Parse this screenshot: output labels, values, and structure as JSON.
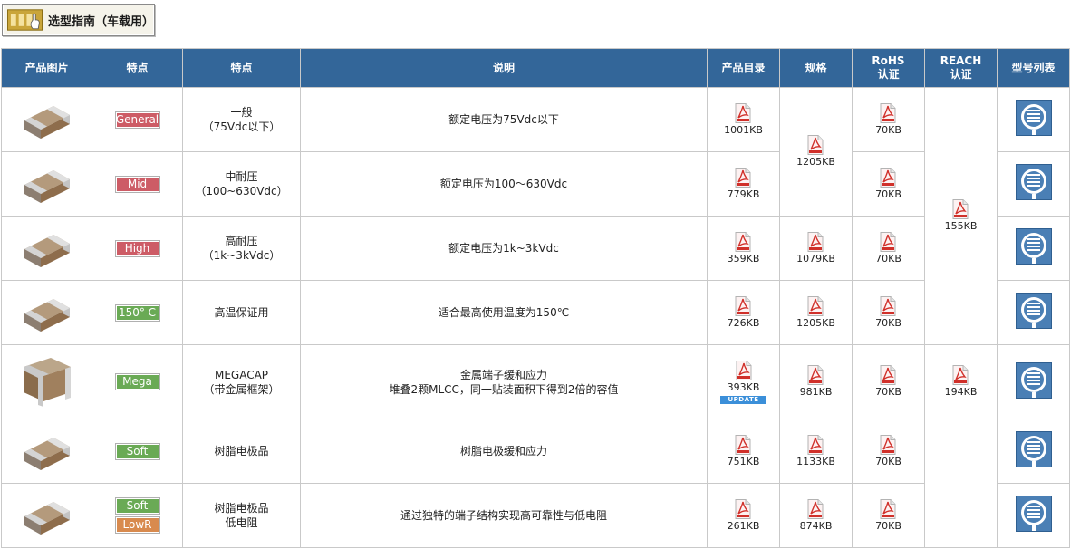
{
  "guide": {
    "label": "选型指南（车载用）",
    "icon": "guide-hand-icon"
  },
  "colors": {
    "header_bg": "#336699",
    "badge_red": "#cd5c66",
    "badge_green": "#6aaa55",
    "badge_orange": "#d88a4e",
    "update_badge": "#3b8fd9",
    "list_button": "#4a7fb5"
  },
  "headers": {
    "image": "产品图片",
    "feature_badge": "特点",
    "feature": "特点",
    "description": "说明",
    "catalog": "产品目录",
    "spec": "规格",
    "rohs_line1": "RoHS",
    "rohs_line2": "认证",
    "reach_line1": "REACH",
    "reach_line2": "认证",
    "model_list": "型号列表"
  },
  "rows": [
    {
      "badges": [
        {
          "text": "General",
          "color": "#cd5c66"
        }
      ],
      "feature": "一般\n（75Vdc以下）",
      "description": [
        "额定电压为75Vdc以下"
      ],
      "catalog": "1001KB",
      "spec": "1205KB",
      "rohs": "70KB",
      "reach": "155KB"
    },
    {
      "badges": [
        {
          "text": "Mid",
          "color": "#cd5c66"
        }
      ],
      "feature": "中耐压\n（100~630Vdc）",
      "description": [
        "额定电压为100～630Vdc"
      ],
      "catalog": "779KB",
      "spec": "",
      "rohs": "70KB",
      "reach": ""
    },
    {
      "badges": [
        {
          "text": "High",
          "color": "#cd5c66"
        }
      ],
      "feature": "高耐压\n（1k~3kVdc）",
      "description": [
        "额定电压为1k~3kVdc"
      ],
      "catalog": "359KB",
      "spec": "1079KB",
      "rohs": "70KB",
      "reach": ""
    },
    {
      "badges": [
        {
          "text": "150° C",
          "color": "#6aaa55"
        }
      ],
      "feature": "高温保证用",
      "description": [
        "适合最高使用温度为150℃"
      ],
      "catalog": "726KB",
      "spec": "1205KB",
      "rohs": "70KB",
      "reach": ""
    },
    {
      "badges": [
        {
          "text": "Mega",
          "color": "#6aaa55"
        }
      ],
      "feature": "MEGACAP\n（带金属框架）",
      "description": [
        "金属端子缓和应力",
        "堆叠2颗MLCC，同一贴装面积下得到2倍的容值"
      ],
      "catalog": "393KB",
      "catalog_update": "UPDATE",
      "spec": "981KB",
      "rohs": "70KB",
      "reach": "194KB"
    },
    {
      "badges": [
        {
          "text": "Soft",
          "color": "#6aaa55"
        }
      ],
      "feature": "树脂电极品",
      "description": [
        "树脂电极缓和应力"
      ],
      "catalog": "751KB",
      "spec": "1133KB",
      "rohs": "70KB",
      "reach": ""
    },
    {
      "badges": [
        {
          "text": "Soft",
          "color": "#6aaa55"
        },
        {
          "text": "LowR",
          "color": "#d88a4e"
        }
      ],
      "feature": "树脂电极品\n低电阻",
      "description": [
        "通过独特的端子结构实现高可靠性与低电阻"
      ],
      "catalog": "261KB",
      "spec": "874KB",
      "rohs": "70KB",
      "reach": ""
    }
  ],
  "icons": {
    "pdf": "pdf-file-icon",
    "model_list": "list-document-icon",
    "chip": "mlcc-chip-icon",
    "mega_chip": "megacap-chip-icon"
  }
}
